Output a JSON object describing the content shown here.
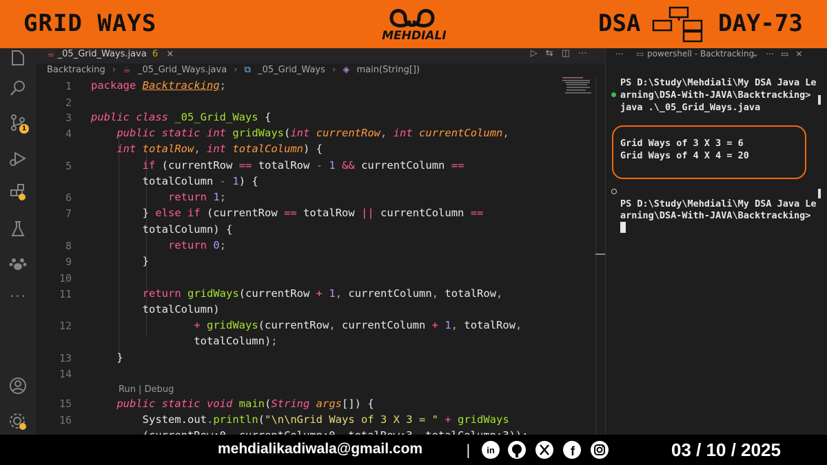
{
  "banner": {
    "title": "GRID WAYS",
    "logo_text": "MEHDIALI",
    "dsa": "DSA",
    "day": "DAY-73",
    "accent": "#f26a0f"
  },
  "editor": {
    "tab_label": "_05_Grid_Ways.java",
    "tab_badge": "6",
    "breadcrumb": [
      "Backtracking",
      "_05_Grid_Ways.java",
      "_05_Grid_Ways",
      "main(String[])"
    ],
    "codelens": "Run | Debug",
    "line_numbers": [
      "1",
      "2",
      "3",
      "4",
      "5",
      "6",
      "7",
      "8",
      "9",
      "10",
      "11",
      "12",
      "13",
      "14",
      "15",
      "16"
    ]
  },
  "terminal": {
    "tab_label": "powershell - Backtracking",
    "prompt1_a": "PS D:\\Study\\Mehdiali\\My DSA Java Le",
    "prompt1_b": "arning\\DSA-With-JAVA\\Backtracking>",
    "command": "java .\\_05_Grid_Ways.java",
    "output1": "Grid Ways of 3 X 3 = 6",
    "output2": "Grid Ways of 4 X 4 = 20",
    "prompt2_a": "PS D:\\Study\\Mehdiali\\My DSA Java Le",
    "prompt2_b": "arning\\DSA-With-JAVA\\Backtracking>"
  },
  "activity_bar": {
    "icons": [
      "explorer-icon",
      "search-icon",
      "source-control-icon",
      "run-debug-icon",
      "extensions-icon",
      "testing-icon",
      "paw-icon",
      "more-icon",
      "account-icon",
      "settings-icon"
    ],
    "scm_badge": "1"
  },
  "footer": {
    "email": "mehdialikadiwala@gmail.com",
    "separator": "|",
    "date": "03 / 10 / 2025",
    "social_icons": [
      "linkedin-icon",
      "github-icon",
      "x-icon",
      "facebook-icon",
      "instagram-icon"
    ]
  }
}
